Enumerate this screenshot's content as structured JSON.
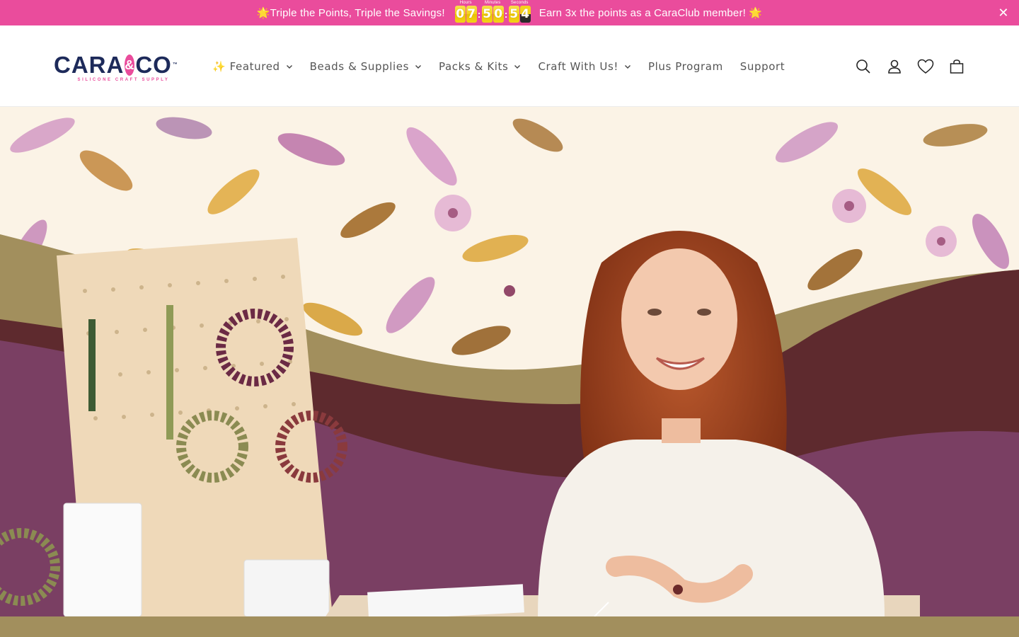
{
  "announcement": {
    "left_text": "🌟Triple the Points, Triple the Savings!",
    "right_text": "Earn 3x the points as a CaraClub member! 🌟",
    "countdown": {
      "hours_label": "Hours",
      "minutes_label": "Minutes",
      "seconds_label": "Seconds",
      "hours": [
        "0",
        "7"
      ],
      "minutes": [
        "5",
        "0"
      ],
      "seconds": [
        "5",
        "4"
      ]
    },
    "close_icon": "close-icon",
    "close_glyph": "✕",
    "bg_color": "#ea4c9c"
  },
  "brand": {
    "name_left": "CARA",
    "name_amp": "&",
    "name_right": "CO",
    "tm": "™",
    "tagline": "SILICONE CRAFT SUPPLY",
    "navy": "#1d2a5a",
    "pink": "#ea4c9c"
  },
  "nav": {
    "items": [
      {
        "label": "✨ Featured",
        "has_dropdown": true
      },
      {
        "label": "Beads & Supplies",
        "has_dropdown": true
      },
      {
        "label": "Packs & Kits",
        "has_dropdown": true
      },
      {
        "label": "Craft With Us!",
        "has_dropdown": true
      },
      {
        "label": "Plus Program",
        "has_dropdown": false
      },
      {
        "label": "Support",
        "has_dropdown": false
      }
    ]
  },
  "header_icons": [
    "search-icon",
    "account-icon",
    "wishlist-heart-icon",
    "cart-icon"
  ],
  "hero": {
    "colors": {
      "cream": "#fbf3e6",
      "olive": "#a28f5d",
      "plum": "#7a3f63",
      "maroon": "#5e2a2e"
    }
  }
}
